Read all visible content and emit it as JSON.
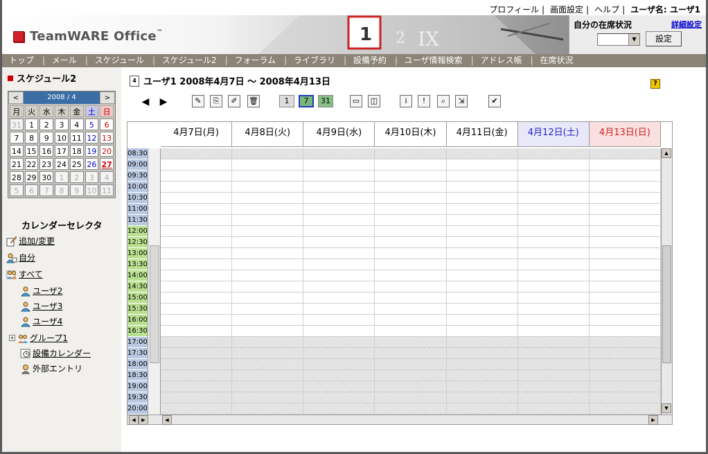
{
  "top_links": {
    "profile": "プロフィール",
    "display_settings": "画面設定",
    "help": "ヘルプ",
    "username": "ユーザ名: ユーザ1"
  },
  "brand": {
    "name": "TeamWARE Office",
    "mark": "™"
  },
  "presence": {
    "label": "自分の在席状況",
    "detail_link": "詳細設定",
    "set_button": "設定",
    "select_value": ""
  },
  "nav": [
    "トップ",
    "メール",
    "スケジュール",
    "スケジュール2",
    "フォーラム",
    "ライブラリ",
    "設備予約",
    "ユーザ情報検索",
    "アドレス帳",
    "在席状況"
  ],
  "left": {
    "module_title": "スケジュール2",
    "minical": {
      "month": "2008 / 4",
      "prev": "<",
      "next": ">",
      "weekdays": [
        "月",
        "火",
        "水",
        "木",
        "金",
        "土",
        "日"
      ],
      "days": [
        [
          "31",
          "1",
          "2",
          "3",
          "4",
          "5",
          "6"
        ],
        [
          "7",
          "8",
          "9",
          "10",
          "11",
          "12",
          "13"
        ],
        [
          "14",
          "15",
          "16",
          "17",
          "18",
          "19",
          "20"
        ],
        [
          "21",
          "22",
          "23",
          "24",
          "25",
          "26",
          "27"
        ],
        [
          "28",
          "29",
          "30",
          "1",
          "2",
          "3",
          "4"
        ],
        [
          "5",
          "6",
          "7",
          "8",
          "9",
          "10",
          "11"
        ]
      ]
    },
    "calendar_selector": "カレンダーセレクタ",
    "items": {
      "add_change": "追加/変更",
      "self": "自分",
      "all": "すべて",
      "user2": "ユーザ2",
      "user3": "ユーザ3",
      "user4": "ユーザ4",
      "group1": "グループ1",
      "facility": "設備カレンダー",
      "external": "外部エントリ"
    }
  },
  "main": {
    "title": "ユーザ1  2008年4月7日 〜 2008年4月13日",
    "views": [
      "1",
      "7",
      "31"
    ],
    "days": [
      "4月7日(月)",
      "4月8日(火)",
      "4月9日(水)",
      "4月10日(木)",
      "4月11日(金)",
      "4月12日(土)",
      "4月13日(日)"
    ],
    "times": [
      "08:30",
      "09:00",
      "09:30",
      "10:00",
      "10:30",
      "11:00",
      "11:30",
      "12:00",
      "12:30",
      "13:00",
      "13:30",
      "14:00",
      "14:30",
      "15:00",
      "15:30",
      "16:00",
      "16:30",
      "17:00",
      "17:30",
      "18:00",
      "18:30",
      "19:00",
      "19:30",
      "20:00"
    ]
  }
}
